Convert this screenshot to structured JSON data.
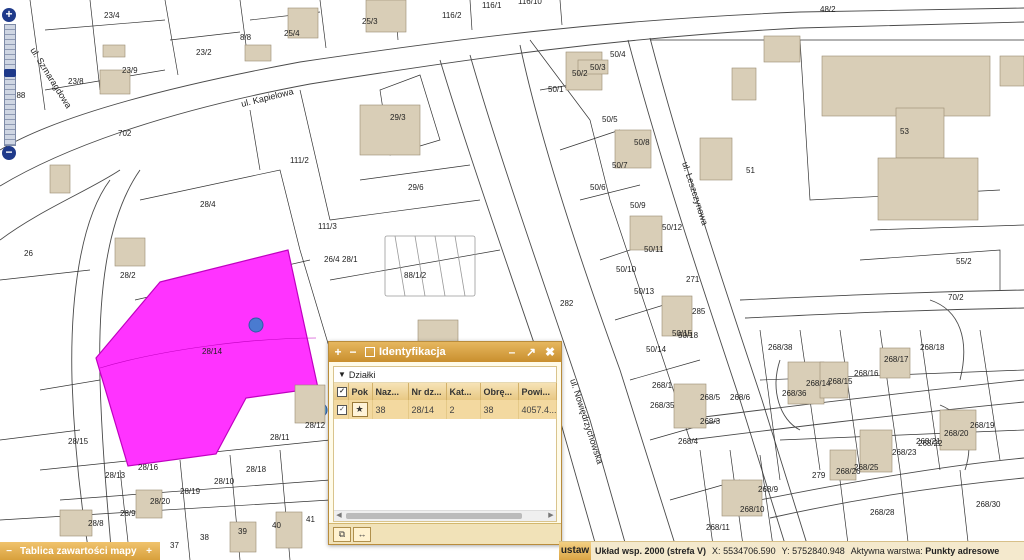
{
  "map": {
    "streets": [
      {
        "name": "ul. Szmaragdowa"
      },
      {
        "name": "ul. Kapielowa"
      },
      {
        "name": "ul. Leszczynowa"
      },
      {
        "name": "ul. Nowiędrzychowska"
      }
    ],
    "parcels": [
      "23/4",
      "23/2",
      "23/8",
      "23/9",
      "25/4",
      "25/3",
      "8/8",
      "788",
      "28/2",
      "28/4",
      "28/14",
      "28/15",
      "28/16",
      "28/11",
      "28/12",
      "28/18",
      "28/19",
      "28/10",
      "28/20",
      "28/9",
      "28/8",
      "28/13",
      "26",
      "29/3",
      "29/6",
      "111/2",
      "111/3",
      "88/1/2",
      "26/4",
      "28/1",
      "50/1",
      "50/2",
      "50/3",
      "50/4",
      "50/5",
      "50/6",
      "50/7",
      "50/8",
      "50/9",
      "50/10",
      "50/11",
      "50/12",
      "50/13",
      "50/14",
      "50/15",
      "50/18",
      "285",
      "271",
      "282",
      "51",
      "53",
      "55/2",
      "70/2",
      "268/38",
      "268/17",
      "268/18",
      "268/36",
      "268/14",
      "268/15",
      "268/16",
      "268/1",
      "268/35",
      "268/5",
      "268/6",
      "268/4",
      "268/3",
      "268/9",
      "268/10",
      "268/11",
      "268/22",
      "268/23",
      "268/19",
      "268/20",
      "268/21",
      "268/25",
      "268/26",
      "279",
      "268/30",
      "268/28",
      "38",
      "39",
      "40",
      "41",
      "37",
      "116/1",
      "116/10",
      "116/2",
      "48/2",
      "702"
    ],
    "selected_parcel_color": "#ff33ff",
    "marker_color": "#4a7bd0"
  },
  "zoom": {
    "plus": "+",
    "minus": "−"
  },
  "panel": {
    "title": "Identyfikacja",
    "plus": "+",
    "minus": "−",
    "section": "Działki",
    "columns": [
      "Pok",
      "Naz...",
      "Nr dz...",
      "Kat...",
      "Obrę...",
      "Powi..."
    ],
    "rows": [
      {
        "pok": "★",
        "naz": "38",
        "nr": "28/14",
        "kat": "2",
        "obr": "38",
        "pow": "4057.4..."
      }
    ]
  },
  "toc": {
    "minus": "−",
    "label": "Tablica zawartości mapy",
    "plus": "+"
  },
  "status": {
    "ustaw": "ustaw",
    "coord_system": "Układ wsp. 2000 (strefa V)",
    "x_label": "X:",
    "x_value": "5534706.590",
    "y_label": "Y:",
    "y_value": "5752840.948",
    "layer_label": "Aktywna warstwa:",
    "layer_value": "Punkty adresowe"
  }
}
